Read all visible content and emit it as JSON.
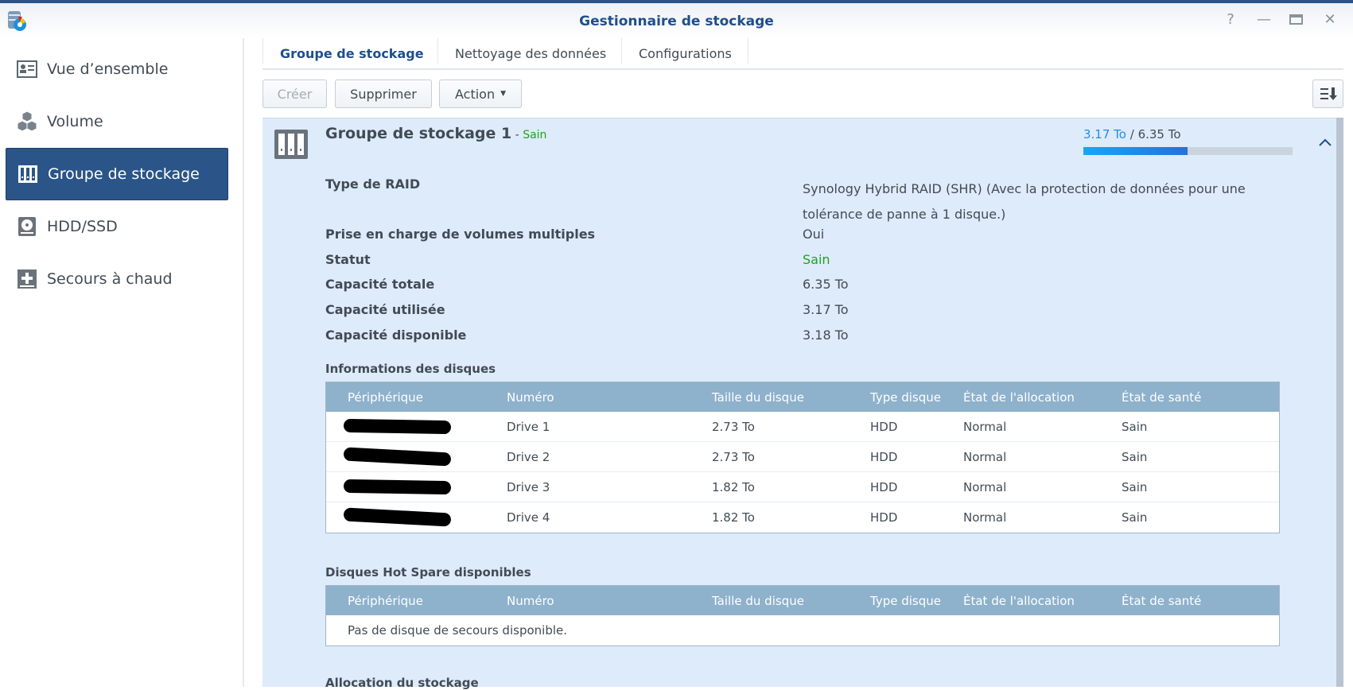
{
  "window": {
    "title": "Gestionnaire de stockage",
    "controls": [
      "help",
      "minimize",
      "maximize",
      "close"
    ]
  },
  "sidebar": {
    "items": [
      {
        "label": "Vue d’ensemble",
        "icon": "overview-icon"
      },
      {
        "label": "Volume",
        "icon": "volume-icon"
      },
      {
        "label": "Groupe de stockage",
        "icon": "storage-pool-icon",
        "active": true
      },
      {
        "label": "HDD/SSD",
        "icon": "hdd-icon"
      },
      {
        "label": "Secours à chaud",
        "icon": "hot-spare-icon"
      }
    ]
  },
  "tabs": [
    "Groupe de stockage",
    "Nettoyage des données",
    "Configurations"
  ],
  "toolbar": {
    "create": "Créer",
    "delete": "Supprimer",
    "action": "Action"
  },
  "pool": {
    "name": "Groupe de stockage 1",
    "separator": " - ",
    "status": "Sain",
    "used": "3.17 To",
    "slash": " / ",
    "total": "6.35 To",
    "usage_fraction": 0.499,
    "details": [
      {
        "label": "Type de RAID",
        "value": "Synology Hybrid RAID (SHR) (Avec la protection de données pour une tolérance de panne à 1 disque.)"
      },
      {
        "label": "Prise en charge de volumes multiples",
        "value": "Oui"
      },
      {
        "label": "Statut",
        "value": "Sain"
      },
      {
        "label": "Capacité totale",
        "value": "6.35 To"
      },
      {
        "label": "Capacité utilisée",
        "value": "3.17 To"
      },
      {
        "label": "Capacité disponible",
        "value": "3.18 To"
      }
    ]
  },
  "disks": {
    "title": "Informations des disques",
    "columns": [
      "Périphérique",
      "Numéro",
      "Taille du disque",
      "Type disque",
      "État de l'allocation",
      "État de santé"
    ],
    "rows": [
      {
        "number": "Drive 1",
        "size": "2.73 To",
        "type": "HDD",
        "allocation": "Normal",
        "health": "Sain"
      },
      {
        "number": "Drive 2",
        "size": "2.73 To",
        "type": "HDD",
        "allocation": "Normal",
        "health": "Sain"
      },
      {
        "number": "Drive 3",
        "size": "1.82 To",
        "type": "HDD",
        "allocation": "Normal",
        "health": "Sain"
      },
      {
        "number": "Drive 4",
        "size": "1.82 To",
        "type": "HDD",
        "allocation": "Normal",
        "health": "Sain"
      }
    ]
  },
  "hotspare": {
    "title": "Disques Hot Spare disponibles",
    "columns": [
      "Périphérique",
      "Numéro",
      "Taille du disque",
      "Type disque",
      "État de l'allocation",
      "État de santé"
    ],
    "empty": "Pas de disque de secours disponible."
  },
  "allocation": {
    "title": "Allocation du stockage"
  },
  "colors": {
    "accent": "#2b5588",
    "healthy": "#22a022",
    "used": "#1e8fe8"
  }
}
